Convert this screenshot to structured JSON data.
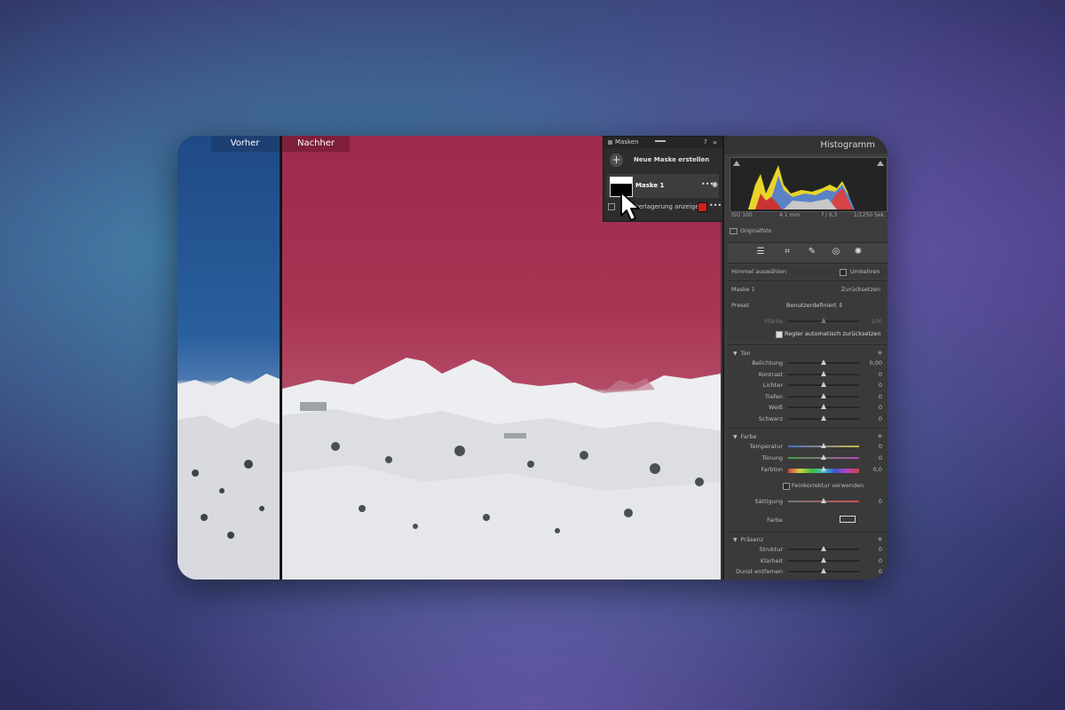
{
  "panes": {
    "before_label": "Vorher",
    "after_label": "Nachher"
  },
  "masks_panel": {
    "title": "Masken",
    "help": "?",
    "collapse": "»",
    "new_mask": "Neue Maske erstellen",
    "mask_name": "Maske 1",
    "overlay_label": "Überlagerung anzeigen",
    "overlay_color": "#cc2222"
  },
  "histogram": {
    "title": "Histogramm",
    "exif": {
      "iso": "ISO 100",
      "focal": "4.1 mm",
      "aperture": "f / 6,3",
      "shutter": "1/1250 Sek."
    },
    "original_label": "Originalfoto"
  },
  "tools": [
    "sliders-icon",
    "crop-icon",
    "heal-icon",
    "redeye-icon",
    "mask-icon"
  ],
  "mask_settings": {
    "select_sky": "Himmel auswählen",
    "invert": "Umkehren",
    "mask_label": "Maske 1",
    "reset": "Zurücksetzen",
    "preset_label": "Preset",
    "preset_value": "Benutzerdefiniert",
    "amount_label": "Stärke",
    "amount_value": "100",
    "auto_reset": "Regler automatisch zurücksetzen"
  },
  "ton": {
    "title": "Ton",
    "sliders": [
      {
        "label": "Belichtung",
        "value": "0,00",
        "position": 0.5
      },
      {
        "label": "Kontrast",
        "value": "0",
        "position": 0.5
      },
      {
        "label": "Lichter",
        "value": "0",
        "position": 0.5
      },
      {
        "label": "Tiefen",
        "value": "0",
        "position": 0.5
      },
      {
        "label": "Weiß",
        "value": "0",
        "position": 0.5
      },
      {
        "label": "Schwarz",
        "value": "0",
        "position": 0.5
      }
    ]
  },
  "farbe": {
    "title": "Farbe",
    "sliders": [
      {
        "label": "Temperatur",
        "value": "0",
        "position": 0.5
      },
      {
        "label": "Tönung",
        "value": "0",
        "position": 0.5
      },
      {
        "label": "Farbton",
        "value": "0,0",
        "position": 0.5
      }
    ],
    "fine_tune": "Feinkorrektur verwenden",
    "saturation": {
      "label": "Sättigung",
      "value": "0",
      "position": 0.5
    },
    "color_label": "Farbe"
  },
  "praesenz": {
    "title": "Präsenz",
    "sliders": [
      {
        "label": "Struktur",
        "value": "0",
        "position": 0.5
      },
      {
        "label": "Klarheit",
        "value": "0",
        "position": 0.5
      },
      {
        "label": "Dunst entfernen",
        "value": "0",
        "position": 0.5
      }
    ]
  }
}
